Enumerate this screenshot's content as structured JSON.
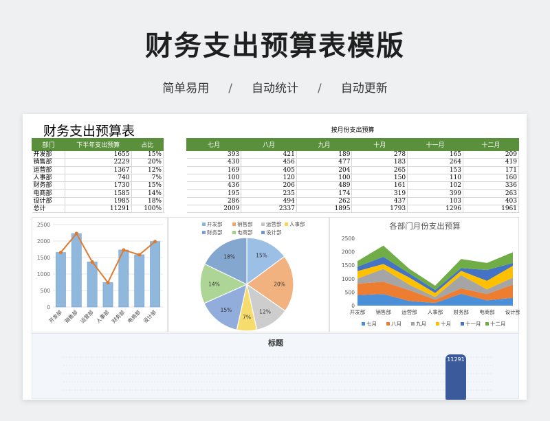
{
  "hero": {
    "title": "财务支出预算表模版",
    "tags": [
      "简单易用",
      "自动统计",
      "自动更新"
    ],
    "separator": "/"
  },
  "sheet": {
    "title": "财务支出预算表",
    "month_caption": "按月份支出预算"
  },
  "summary_table": {
    "headers": [
      "部门",
      "下半年支出预算",
      "占比"
    ],
    "rows": [
      [
        "开发部",
        "1655",
        "15%"
      ],
      [
        "销售部",
        "2229",
        "20%"
      ],
      [
        "运营部",
        "1367",
        "12%"
      ],
      [
        "人事部",
        "740",
        "7%"
      ],
      [
        "财务部",
        "1730",
        "15%"
      ],
      [
        "电商部",
        "1585",
        "14%"
      ],
      [
        "设计部",
        "1985",
        "18%"
      ],
      [
        "总计",
        "11291",
        "100%"
      ]
    ]
  },
  "month_table": {
    "headers": [
      "七月",
      "八月",
      "九月",
      "十月",
      "十一月",
      "十二月"
    ],
    "rows": [
      [
        "393",
        "421",
        "189",
        "278",
        "165",
        "209"
      ],
      [
        "430",
        "456",
        "477",
        "183",
        "264",
        "419"
      ],
      [
        "169",
        "405",
        "204",
        "265",
        "153",
        "171"
      ],
      [
        "100",
        "120",
        "100",
        "150",
        "110",
        "160"
      ],
      [
        "436",
        "206",
        "489",
        "161",
        "102",
        "336"
      ],
      [
        "195",
        "235",
        "174",
        "319",
        "399",
        "263"
      ],
      [
        "286",
        "494",
        "262",
        "437",
        "103",
        "403"
      ],
      [
        "2009",
        "2337",
        "1895",
        "1793",
        "1296",
        "1961"
      ]
    ]
  },
  "chart_data": [
    {
      "type": "bar",
      "categories": [
        "开发部",
        "销售部",
        "运营部",
        "人事部",
        "财务部",
        "电商部",
        "设计部"
      ],
      "values": [
        1655,
        2229,
        1367,
        740,
        1730,
        1585,
        1985
      ],
      "line_values": [
        1655,
        2229,
        1367,
        740,
        1730,
        1585,
        1985
      ],
      "ylim": [
        0,
        2500
      ],
      "yticks": [
        "0",
        "500",
        "1000",
        "1500",
        "2000",
        "2500"
      ],
      "bar_color": "#8fb8dc",
      "line_color": "#e07a2f",
      "title": ""
    },
    {
      "type": "pie",
      "labels": [
        "开发部",
        "销售部",
        "运营部",
        "人事部",
        "财务部",
        "电商部",
        "设计部"
      ],
      "values": [
        15,
        20,
        12,
        7,
        15,
        14,
        18
      ],
      "slice_labels": [
        "15%",
        "20%",
        "12%",
        "7%",
        "15%",
        "14%",
        "18%"
      ],
      "colors": [
        "#8ab4e0",
        "#f0a46a",
        "#c4c4c4",
        "#f5d553",
        "#7f9fd6",
        "#9fcf84",
        "#6f98c8"
      ],
      "legend": "top",
      "title": ""
    },
    {
      "type": "area",
      "title": "各部门月份支出预算",
      "categories": [
        "开发部",
        "销售部",
        "运营部",
        "人事部",
        "财务部",
        "电商部",
        "设计部"
      ],
      "series": [
        {
          "name": "七月",
          "values": [
            393,
            430,
            169,
            100,
            436,
            195,
            286
          ],
          "color": "#4a8fd8"
        },
        {
          "name": "八月",
          "values": [
            421,
            456,
            405,
            120,
            206,
            235,
            494
          ],
          "color": "#ed7d31"
        },
        {
          "name": "九月",
          "values": [
            189,
            477,
            204,
            100,
            489,
            174,
            262
          ],
          "color": "#a5a5a5"
        },
        {
          "name": "十月",
          "values": [
            278,
            183,
            265,
            150,
            161,
            319,
            437
          ],
          "color": "#ffc000"
        },
        {
          "name": "十一月",
          "values": [
            165,
            264,
            153,
            110,
            102,
            399,
            103
          ],
          "color": "#4472c4"
        },
        {
          "name": "十二月",
          "values": [
            209,
            419,
            171,
            160,
            336,
            263,
            403
          ],
          "color": "#70ad47"
        }
      ],
      "ylim": [
        0,
        2500
      ],
      "yticks": [
        "0",
        "250",
        "500",
        "750",
        "1000",
        "1250",
        "1500",
        "1750",
        "2000",
        "2250",
        "2500"
      ],
      "legend": "bottom"
    },
    {
      "type": "bar",
      "title": "标题",
      "categories": [
        ""
      ],
      "values": [
        11291
      ],
      "data_label": "11291",
      "bar_color": "#3a5a9c"
    }
  ]
}
